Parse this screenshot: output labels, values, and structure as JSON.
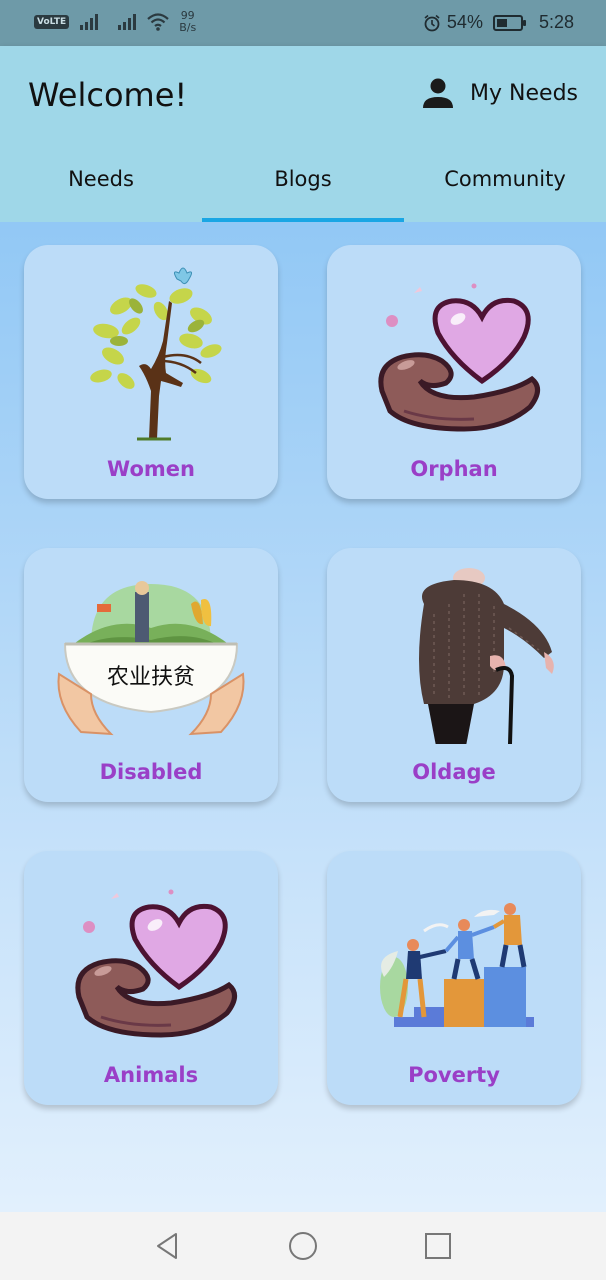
{
  "status_bar": {
    "volte": "VoLTE",
    "net_speed_value": "99",
    "net_speed_unit": "B/s",
    "battery_percent": "54%",
    "battery_level": 0.54,
    "time": "5:28",
    "icons": [
      "signal-icon",
      "signal-icon",
      "wifi-icon",
      "alarm-icon",
      "battery-icon"
    ]
  },
  "app_bar": {
    "title": "Welcome!",
    "my_needs_label": "My Needs",
    "my_needs_icon": "person-icon"
  },
  "tabs": [
    {
      "label": "Needs",
      "active": false
    },
    {
      "label": "Blogs",
      "active": true
    },
    {
      "label": "Community",
      "active": false
    }
  ],
  "categories": [
    {
      "label": "Women",
      "image": "woman-tree-illustration"
    },
    {
      "label": "Orphan",
      "image": "heart-in-hand-illustration"
    },
    {
      "label": "Disabled",
      "image": "bowl-in-hands-illustration"
    },
    {
      "label": "Oldage",
      "image": "elderly-person-cane-illustration"
    },
    {
      "label": "Animals",
      "image": "heart-in-hand-illustration"
    },
    {
      "label": "Poverty",
      "image": "people-helping-climb-illustration"
    }
  ],
  "bowl_text": "农业扶贫",
  "nav_bar": {
    "icons": [
      "back-icon",
      "home-icon",
      "recents-icon"
    ]
  },
  "colors": {
    "status_bar": "#6e9aa8",
    "app_bar": "#9fd7e8",
    "tab_indicator": "#1aa6e4",
    "card_background": "#bcdcf8",
    "caption": "#9a3fc7"
  }
}
